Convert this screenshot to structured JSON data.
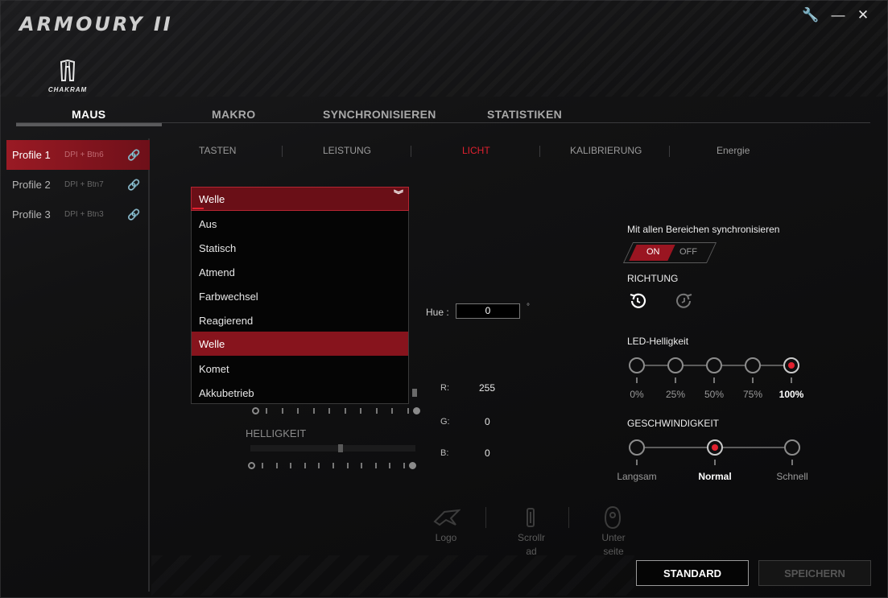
{
  "app": {
    "title": "ARMOURY II",
    "device_name": "CHAKRAM"
  },
  "window_controls": {
    "settings": "🔧",
    "minimize": "—",
    "close": "✕"
  },
  "main_tabs": [
    {
      "label": "MAUS",
      "active": true
    },
    {
      "label": "MAKRO",
      "active": false
    },
    {
      "label": "SYNCHRONISIEREN",
      "active": false
    },
    {
      "label": "STATISTIKEN",
      "active": false
    }
  ],
  "profiles": [
    {
      "name": "Profile 1",
      "shortcut": "DPI + Btn6",
      "active": true
    },
    {
      "name": "Profile 2",
      "shortcut": "DPI + Btn7",
      "active": false
    },
    {
      "name": "Profile 3",
      "shortcut": "DPI + Btn3",
      "active": false
    }
  ],
  "sub_tabs": [
    {
      "label": "TASTEN",
      "active": false
    },
    {
      "label": "LEISTUNG",
      "active": false
    },
    {
      "label": "LICHT",
      "active": true
    },
    {
      "label": "KALIBRIERUNG",
      "active": false
    },
    {
      "label": "Energie",
      "active": false
    }
  ],
  "effect_dropdown": {
    "selected": "Welle",
    "options": [
      "Aus",
      "Statisch",
      "Atmend",
      "Farbwechsel",
      "Reagierend",
      "Welle",
      "Komet",
      "Akkubetrieb"
    ]
  },
  "color": {
    "hue_label": "Hue :",
    "hue_value": "0",
    "hue_unit": "°",
    "r_label": "R:",
    "r_value": "255",
    "g_label": "G:",
    "g_value": "0",
    "b_label": "B:",
    "b_value": "0",
    "brightness_label": "HELLIGKEIT"
  },
  "sync": {
    "label": "Mit allen Bereichen synchronisieren",
    "on": "ON",
    "off": "OFF",
    "state": "ON"
  },
  "direction": {
    "label": "RICHTUNG"
  },
  "led_brightness": {
    "label": "LED-Helligkeit",
    "steps": [
      "0%",
      "25%",
      "50%",
      "75%",
      "100%"
    ],
    "selected_index": 4
  },
  "speed": {
    "label": "GESCHWINDIGKEIT",
    "steps": [
      "Langsam",
      "Normal",
      "Schnell"
    ],
    "selected_index": 1
  },
  "zones": [
    {
      "label_l1": "Logo",
      "label_l2": ""
    },
    {
      "label_l1": "Scrollr",
      "label_l2": "ad"
    },
    {
      "label_l1": "Unter",
      "label_l2": "seite"
    }
  ],
  "buttons": {
    "standard": "STANDARD",
    "save": "SPEICHERN"
  },
  "colors": {
    "accent": "#e0212f",
    "accent_dark": "#87141d",
    "bg": "#0b0b0c"
  }
}
